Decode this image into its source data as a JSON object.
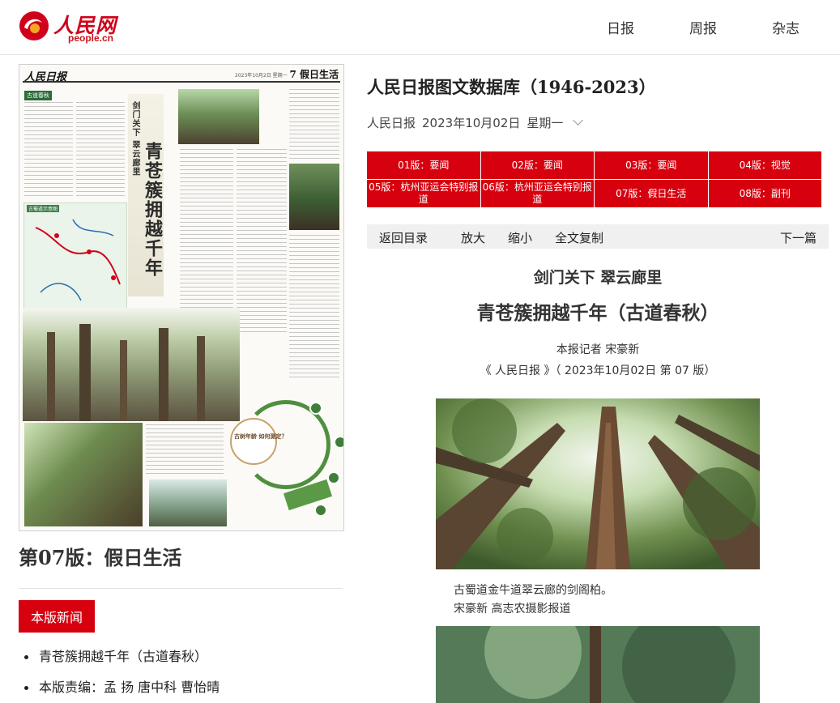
{
  "site": {
    "logo_text": "人民网",
    "logo_sub": "people.cn"
  },
  "topnav": [
    "日报",
    "周报",
    "杂志"
  ],
  "thumbnail": {
    "masthead": "人民日报",
    "date_line": "2023年10月2日 星期一",
    "page_label": "7 假日生活",
    "section_tag": "古道春秋",
    "map_label": "古蜀道示意图",
    "vertical_subtitle": "剑门关下 翠云廊里",
    "vertical_title": "青苍簇拥越千年",
    "infographic_center": "古树年龄 如何测定？"
  },
  "page_caption": "第07版：假日生活",
  "news_tab": "本版新闻",
  "news_list": [
    "青苍簇拥越千年（古道春秋）",
    "本版责编：孟 扬 唐中科 曹怡晴"
  ],
  "db_title": "人民日报图文数据库（1946-2023）",
  "date_row": {
    "paper": "人民日报",
    "date": "2023年10月02日",
    "weekday": "星期一"
  },
  "editions": [
    "01版：要闻",
    "02版：要闻",
    "03版：要闻",
    "04版：视觉",
    "05版：杭州亚运会特别报道",
    "06版：杭州亚运会特别报道",
    "07版：假日生活",
    "08版：副刊"
  ],
  "toolbar": {
    "back": "返回目录",
    "zoom_in": "放大",
    "zoom_out": "缩小",
    "copy": "全文复制",
    "next": "下一篇"
  },
  "article": {
    "subhead": "剑门关下 翠云廊里",
    "headline": "青苍簇拥越千年（古道春秋）",
    "reporter": "本报记者 宋豪新",
    "source": "《 人民日报 》（ 2023年10月02日   第 07 版）",
    "photo_caption_1": "古蜀道金牛道翠云廊的剑阁柏。",
    "photo_caption_2": "宋豪新 高志农摄影报道"
  },
  "colors": {
    "brand_red": "#d7000f",
    "toolbar_bg": "#f0f0f0"
  }
}
